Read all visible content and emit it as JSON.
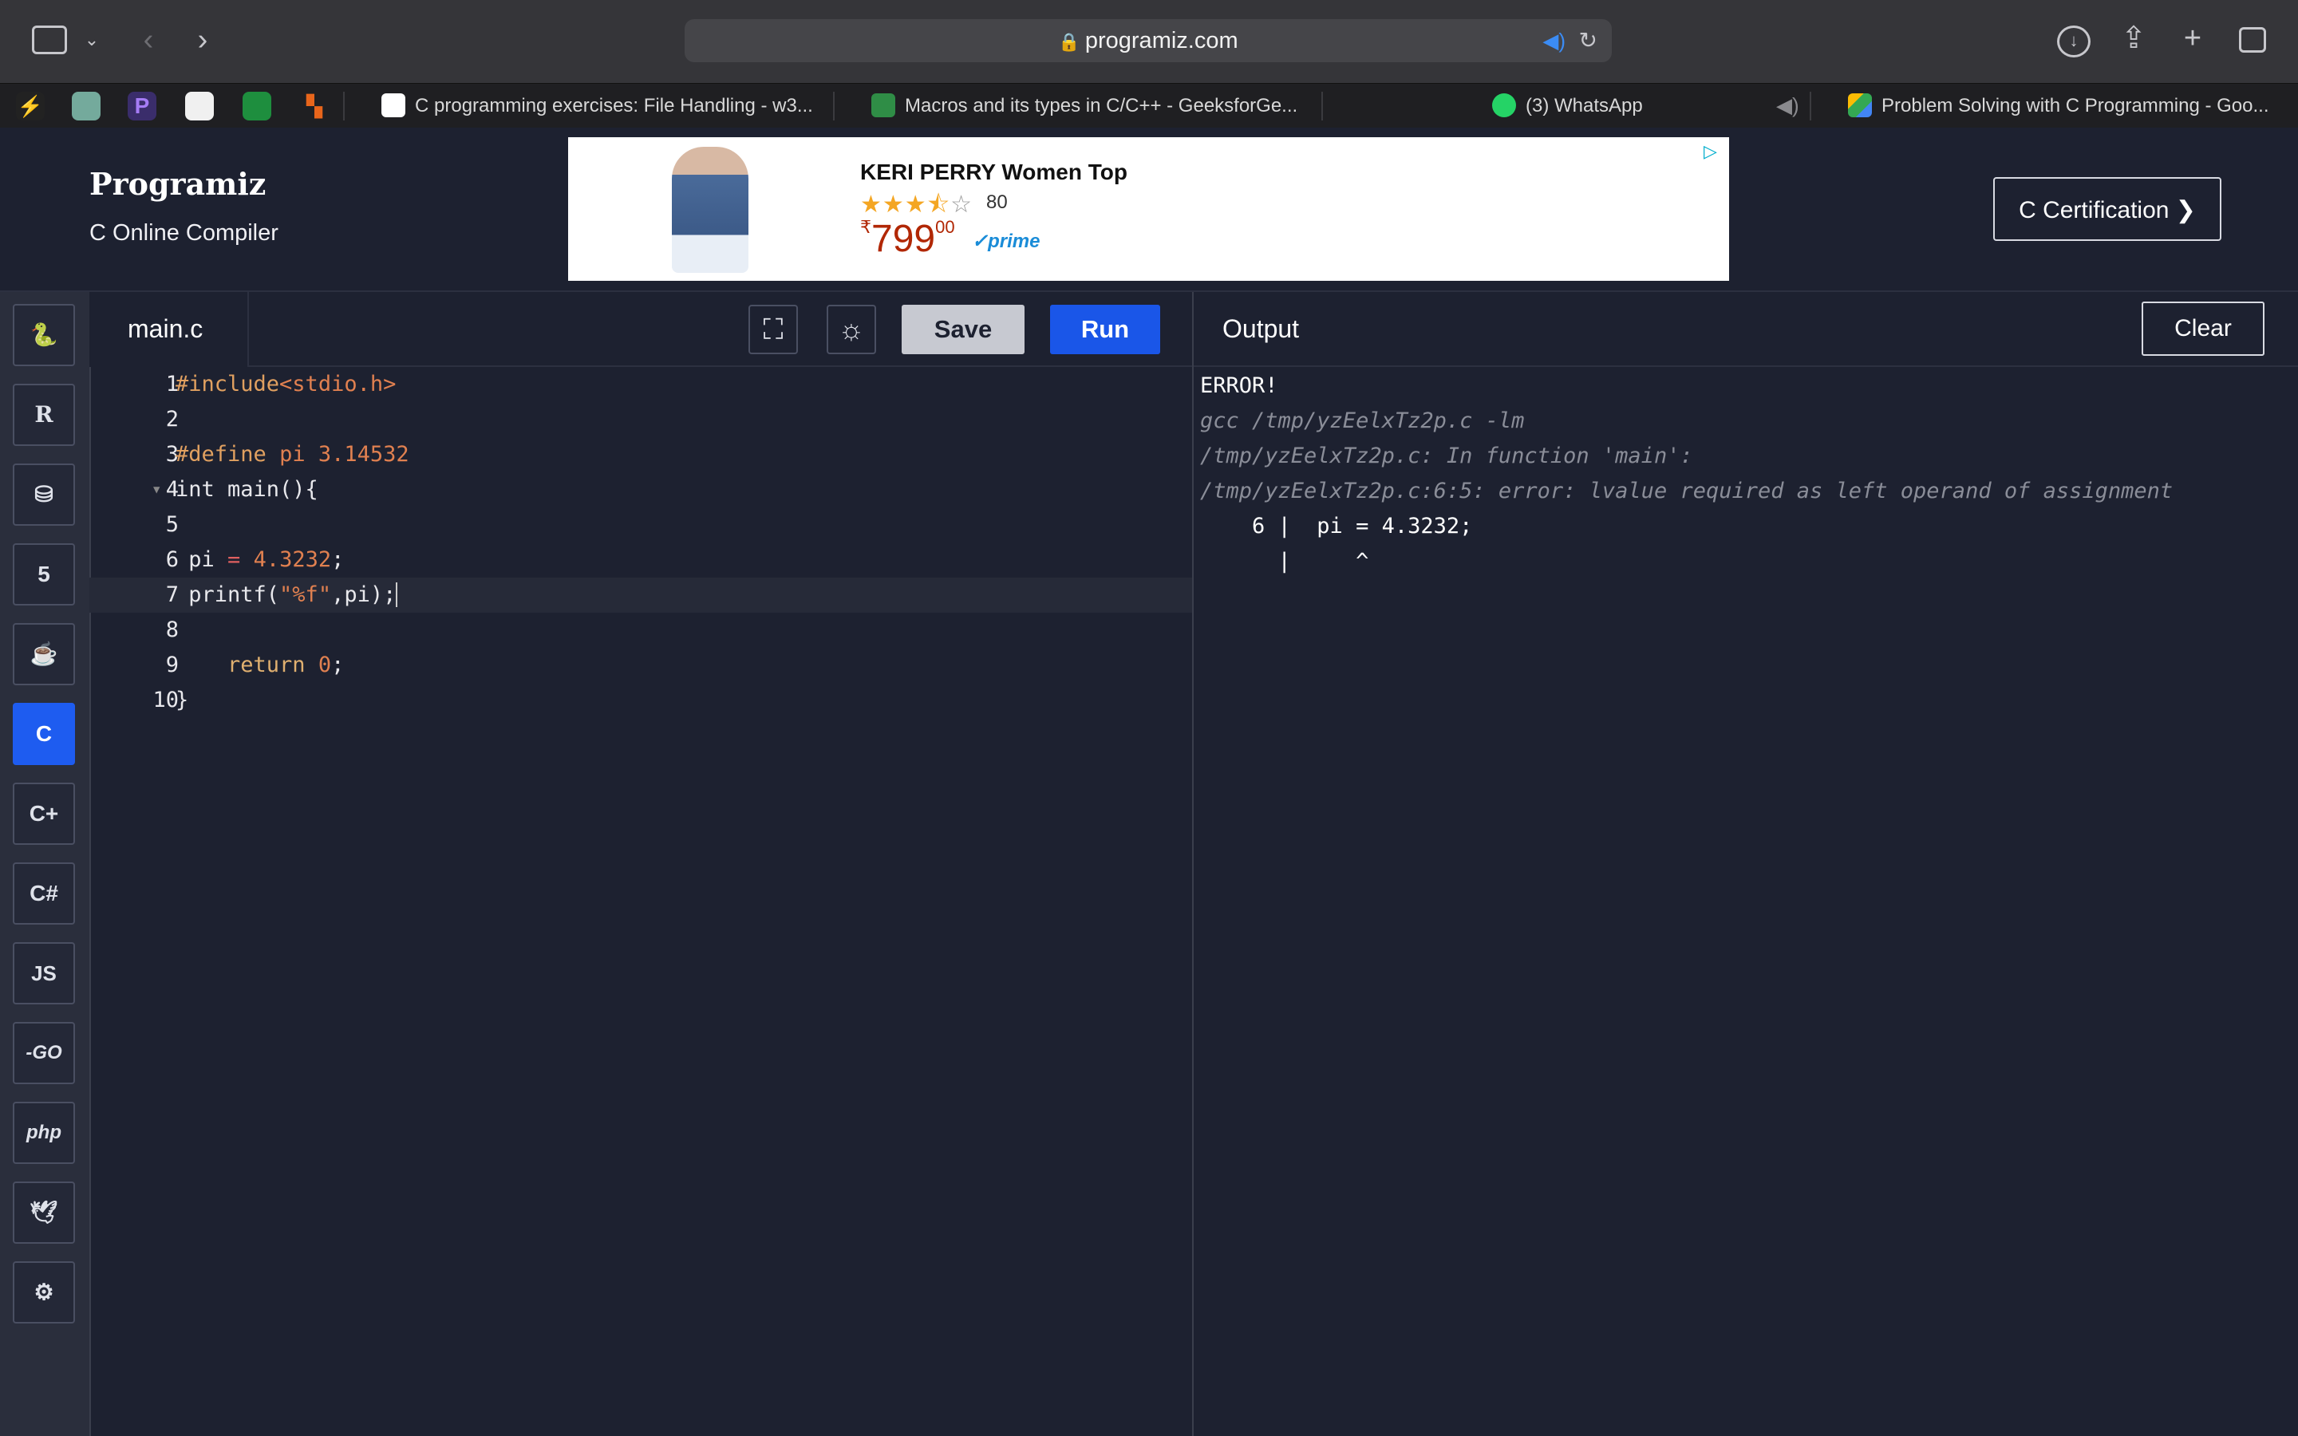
{
  "browser": {
    "url": "programiz.com",
    "pinned_tabs": [
      "pinned-1",
      "pinned-2",
      "pinned-3",
      "pinned-4",
      "pinned-5",
      "pinned-6"
    ],
    "tabs": [
      {
        "label": "C programming exercises: File Handling - w3..."
      },
      {
        "label": "Macros and its types in C/C++ - GeeksforGe..."
      },
      {
        "label": "(3) WhatsApp"
      },
      {
        "label": "Problem Solving with C Programming - Goo..."
      }
    ]
  },
  "header": {
    "logo": "Programiz",
    "subtitle": "C Online Compiler",
    "cert_button": "C Certification ❯"
  },
  "ad": {
    "title": "KERI PERRY Women Top",
    "rating_count": "80",
    "price_symbol": "₹",
    "price": "799",
    "price_cents": "00",
    "prime": "prime"
  },
  "sidebar": {
    "languages": [
      "python",
      "r",
      "sql",
      "html",
      "java",
      "c",
      "cpp",
      "csharp",
      "JS",
      "GO",
      "php",
      "swift",
      "rust"
    ],
    "js_label": "JS",
    "go_label": "-GO",
    "php_label": "php"
  },
  "editor": {
    "file_name": "main.c",
    "save_label": "Save",
    "run_label": "Run",
    "lines": [
      "#include<stdio.h>",
      "",
      "#define pi 3.14532",
      "int main(){",
      "",
      " pi = 4.3232;",
      " printf(\"%f\",pi);",
      "",
      "    return 0;",
      "}"
    ]
  },
  "output": {
    "title": "Output",
    "clear_label": "Clear",
    "lines": [
      "ERROR!",
      "gcc /tmp/yzEelxTz2p.c -lm",
      "/tmp/yzEelxTz2p.c: In function 'main':",
      "/tmp/yzEelxTz2p.c:6:5: error: lvalue required as left operand of assignment",
      "    6 |  pi = 4.3232;",
      "      |     ^"
    ]
  }
}
